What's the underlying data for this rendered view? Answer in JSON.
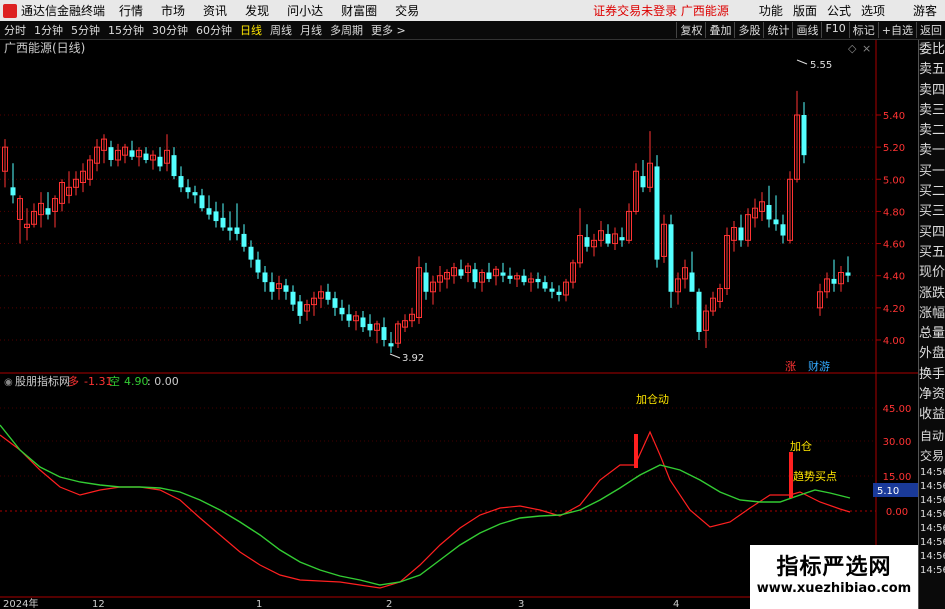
{
  "titlebar": {
    "app": "通达信金融终端",
    "menus": [
      "行情",
      "市场",
      "资讯",
      "发现",
      "问小达",
      "财富圈",
      "交易"
    ],
    "notice": "证券交易未登录 广西能源",
    "right_menus": [
      "功能",
      "版面",
      "公式",
      "选项"
    ],
    "user": "游客"
  },
  "toolbar": {
    "periods": [
      "分时",
      "1分钟",
      "5分钟",
      "15分钟",
      "30分钟",
      "60分钟",
      "日线",
      "周线",
      "月线",
      "多周期",
      "更多 >"
    ],
    "active": "日线",
    "right": [
      "复权",
      "叠加",
      "多股",
      "统计",
      "画线",
      "F10",
      "标记",
      "+自选",
      "返回"
    ]
  },
  "chart": {
    "title": "广西能源(日线)",
    "high_label": "5.55",
    "low_label": "3.92",
    "price_ticks": [
      "5.40",
      "5.20",
      "5.00",
      "4.80",
      "4.60",
      "4.40",
      "4.20",
      "4.00"
    ],
    "markers": {
      "zhang": "涨",
      "caiyou": "财游"
    }
  },
  "indicator": {
    "name": "股朋指标网",
    "duo_label": "多",
    "duo_value": "-1.31",
    "kong_label": "空",
    "kong_value": "4.90",
    "extra": ": 0.00",
    "ticks": [
      "45.00",
      "30.00",
      "15.00",
      "0.00"
    ],
    "badge": "5.10",
    "annotations": [
      "加仓动",
      "加仓",
      "趋势买点"
    ]
  },
  "dates": [
    "2024年",
    "12",
    "1",
    "2",
    "3",
    "4"
  ],
  "rightpanel": {
    "items": [
      "委比",
      "卖五",
      "卖四",
      "卖三",
      "卖二",
      "卖一",
      "买一",
      "买二",
      "买三",
      "买四",
      "买五",
      "现价",
      "涨跌",
      "涨幅",
      "总量",
      "外盘",
      "换手",
      "净资",
      "收益"
    ],
    "items2": [
      "自动",
      "交易"
    ],
    "times": [
      "14:56",
      "14:56",
      "14:56",
      "14:56",
      "14:56",
      "14:56",
      "14:56",
      "14:56"
    ]
  },
  "watermark": {
    "cn": "指标严选网",
    "url": "www.xuezhibiao.com"
  },
  "colors": {
    "up": "#ff3333",
    "down": "#54ffff",
    "red_line": "#ff2020",
    "green_line": "#33cc33"
  }
}
